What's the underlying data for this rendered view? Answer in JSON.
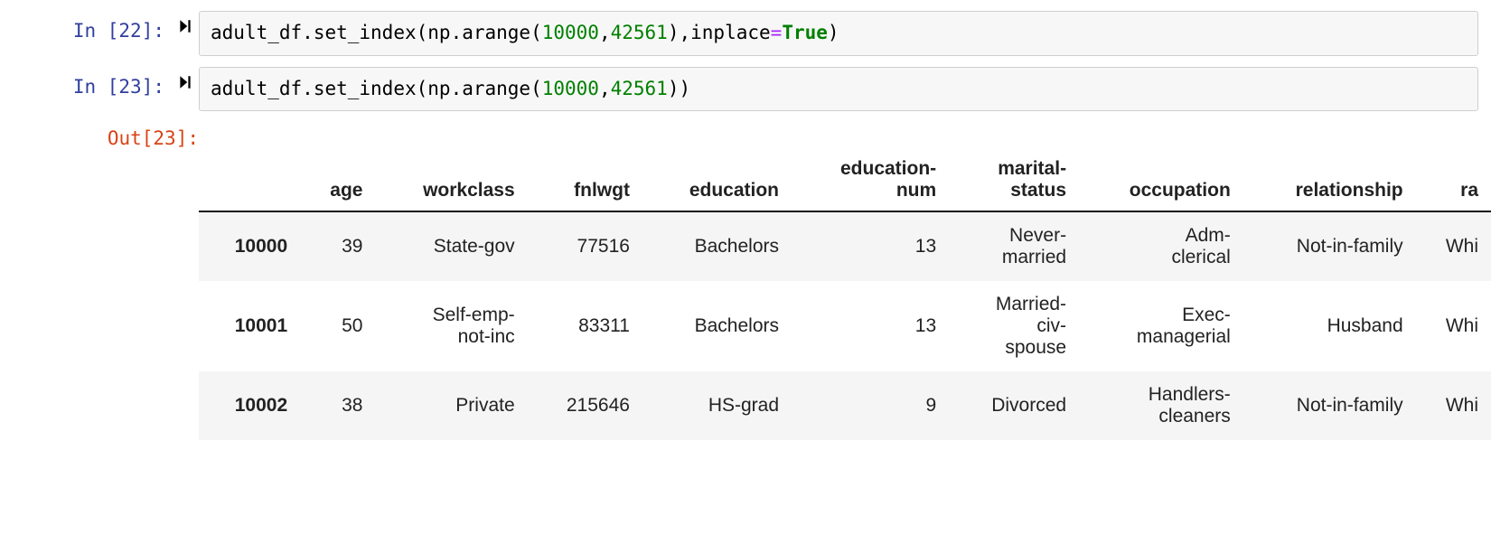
{
  "cells": [
    {
      "in_label": "In [22]:",
      "code_tokens": [
        {
          "t": "adult_df",
          "c": "tok-name"
        },
        {
          "t": ".",
          "c": "tok-punc"
        },
        {
          "t": "set_index",
          "c": "tok-name"
        },
        {
          "t": "(",
          "c": "tok-punc"
        },
        {
          "t": "np",
          "c": "tok-name"
        },
        {
          "t": ".",
          "c": "tok-punc"
        },
        {
          "t": "arange",
          "c": "tok-name"
        },
        {
          "t": "(",
          "c": "tok-punc"
        },
        {
          "t": "10000",
          "c": "tok-num"
        },
        {
          "t": ",",
          "c": "tok-punc"
        },
        {
          "t": "42561",
          "c": "tok-num"
        },
        {
          "t": ")",
          "c": "tok-punc"
        },
        {
          "t": ",",
          "c": "tok-punc"
        },
        {
          "t": "inplace",
          "c": "tok-name"
        },
        {
          "t": "=",
          "c": "tok-op"
        },
        {
          "t": "True",
          "c": "tok-kw"
        },
        {
          "t": ")",
          "c": "tok-punc"
        }
      ]
    },
    {
      "in_label": "In [23]:",
      "code_tokens": [
        {
          "t": "adult_df",
          "c": "tok-name"
        },
        {
          "t": ".",
          "c": "tok-punc"
        },
        {
          "t": "set_index",
          "c": "tok-name"
        },
        {
          "t": "(",
          "c": "tok-punc"
        },
        {
          "t": "np",
          "c": "tok-name"
        },
        {
          "t": ".",
          "c": "tok-punc"
        },
        {
          "t": "arange",
          "c": "tok-name"
        },
        {
          "t": "(",
          "c": "tok-punc"
        },
        {
          "t": "10000",
          "c": "tok-num"
        },
        {
          "t": ",",
          "c": "tok-punc"
        },
        {
          "t": "42561",
          "c": "tok-num"
        },
        {
          "t": ")",
          "c": "tok-punc"
        },
        {
          "t": ")",
          "c": "tok-punc"
        }
      ]
    }
  ],
  "output": {
    "label": "Out[23]:",
    "columns": [
      "age",
      "workclass",
      "fnlwgt",
      "education",
      "education-\nnum",
      "marital-\nstatus",
      "occupation",
      "relationship",
      "ra"
    ],
    "index": [
      "10000",
      "10001",
      "10002"
    ],
    "rows": [
      [
        "39",
        "State-gov",
        "77516",
        "Bachelors",
        "13",
        "Never-\nmarried",
        "Adm-\nclerical",
        "Not-in-family",
        "Whi"
      ],
      [
        "50",
        "Self-emp-\nnot-inc",
        "83311",
        "Bachelors",
        "13",
        "Married-\nciv-\nspouse",
        "Exec-\nmanagerial",
        "Husband",
        "Whi"
      ],
      [
        "38",
        "Private",
        "215646",
        "HS-grad",
        "9",
        "Divorced",
        "Handlers-\ncleaners",
        "Not-in-family",
        "Whi"
      ]
    ]
  }
}
